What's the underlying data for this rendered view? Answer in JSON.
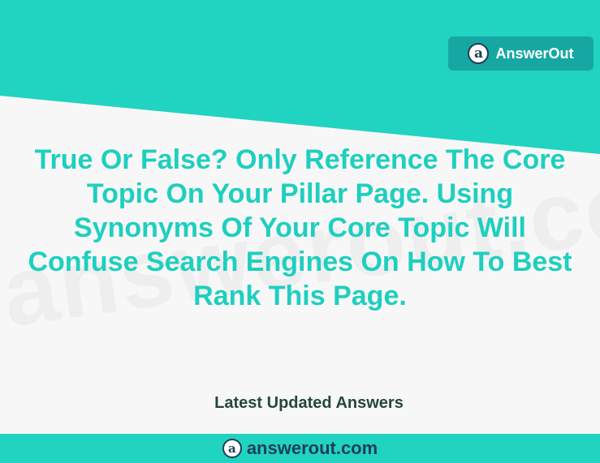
{
  "watermark": "answerout.com",
  "brand": {
    "name": "AnswerOut",
    "logo_letter": "a"
  },
  "question": "True Or False? Only Reference The Core Topic On Your Pillar Page. Using Synonyms Of Your Core Topic Will Confuse Search Engines On How To Best Rank This Page.",
  "latest_updated": "Latest Updated Answers",
  "footer": {
    "site": "answerout.com",
    "logo_letter": "a"
  },
  "colors": {
    "teal_band": "#21d3c1",
    "badge": "#17a7a3",
    "question_text": "#1ecfbf",
    "dark_text": "#26473b"
  }
}
